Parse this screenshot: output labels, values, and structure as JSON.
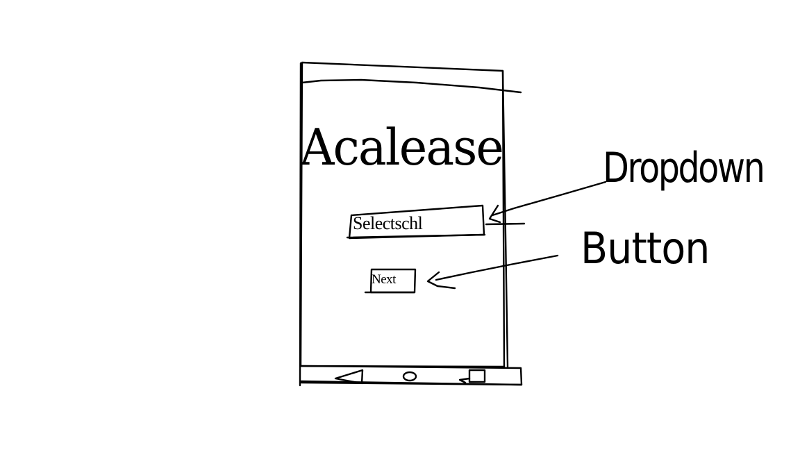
{
  "app": {
    "title": "Acalease"
  },
  "form": {
    "dropdown_label": "Selectschl",
    "next_button_label": "Next"
  },
  "annotations": {
    "dropdown": "Dropdown",
    "button": "Button"
  },
  "nav_bar": {
    "icons": [
      "back-icon",
      "home-icon",
      "recents-icon"
    ]
  },
  "colors": {
    "ink": "#000000",
    "paper": "#ffffff"
  }
}
